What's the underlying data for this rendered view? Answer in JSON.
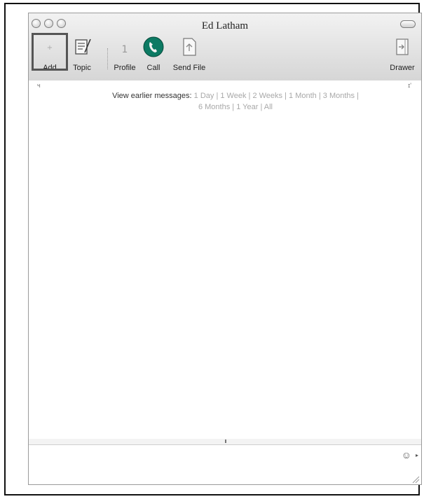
{
  "window": {
    "title": "Ed Latham"
  },
  "toolbar": {
    "items": [
      {
        "label": "Add"
      },
      {
        "label": "Topic"
      },
      {
        "label": "Profile"
      },
      {
        "label": "Call"
      },
      {
        "label": "Send File"
      },
      {
        "label": "Drawer"
      }
    ]
  },
  "history": {
    "prefix": "View earlier messages:",
    "options": [
      "1 Day",
      "1 Week",
      "2 Weeks",
      "1 Month",
      "3 Months",
      "6 Months",
      "1 Year",
      "All"
    ]
  },
  "colors": {
    "call_icon": "#0c7a63",
    "highlight_border": "#555555"
  }
}
